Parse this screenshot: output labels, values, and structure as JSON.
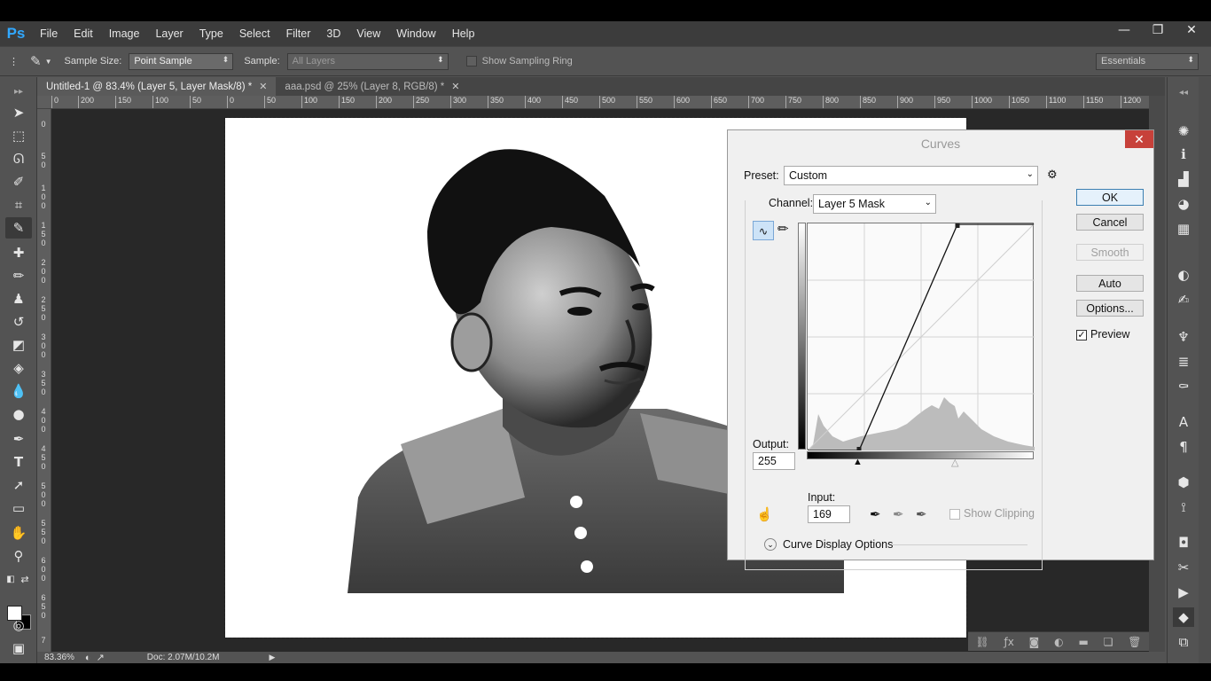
{
  "app": {
    "logo": "Ps",
    "menu": [
      "File",
      "Edit",
      "Image",
      "Layer",
      "Type",
      "Select",
      "Filter",
      "3D",
      "View",
      "Window",
      "Help"
    ],
    "window_controls": [
      "—",
      "❐",
      "✕"
    ]
  },
  "options_bar": {
    "sample_size_label": "Sample Size:",
    "sample_size_value": "Point Sample",
    "sample_label": "Sample:",
    "sample_value": "All Layers",
    "sampling_ring_label": "Show Sampling Ring",
    "workspace": "Essentials"
  },
  "tabs": [
    {
      "label": "Untitled-1 @ 83.4% (Layer 5, Layer Mask/8) *",
      "close": "✕"
    },
    {
      "label": "aaa.psd @ 25% (Layer 8, RGB/8) *",
      "close": "✕"
    }
  ],
  "ruler": {
    "top_ticks": [
      "0",
      "200",
      "150",
      "100",
      "50",
      "0",
      "50",
      "100",
      "150",
      "200",
      "250",
      "300",
      "350",
      "400",
      "450",
      "500",
      "550",
      "600",
      "650",
      "700",
      "750",
      "800",
      "850",
      "900",
      "950",
      "1000",
      "1050",
      "1100",
      "1150",
      "1200"
    ],
    "left_ticks": [
      "0",
      "5 0",
      "1 0 0",
      "1 5 0",
      "2 0 0",
      "2 5 0",
      "3 0 0",
      "3 5 0",
      "4 0 0",
      "4 5 0",
      "5 0 0",
      "5 5 0",
      "6 0 0",
      "6 5 0",
      "7"
    ]
  },
  "status": {
    "zoom": "83.36%",
    "doc": "Doc: 2.07M/10.2M"
  },
  "curves": {
    "title": "Curves",
    "close": "✕",
    "preset_label": "Preset:",
    "preset_value": "Custom",
    "channel_label": "Channel:",
    "channel_value": "Layer 5 Mask",
    "output_label": "Output:",
    "output_value": "255",
    "input_label": "Input:",
    "input_value": "169",
    "show_clipping_label": "Show Clipping",
    "curve_display_options": "Curve Display Options",
    "buttons": {
      "ok": "OK",
      "cancel": "Cancel",
      "smooth": "Smooth",
      "auto": "Auto",
      "options": "Options..."
    },
    "preview_label": "Preview",
    "preview_checked": true,
    "curve_points": [
      [
        0,
        0
      ],
      [
        58,
        0
      ],
      [
        169,
        255
      ],
      [
        255,
        255
      ]
    ],
    "black_input": 58,
    "white_input": 169
  }
}
